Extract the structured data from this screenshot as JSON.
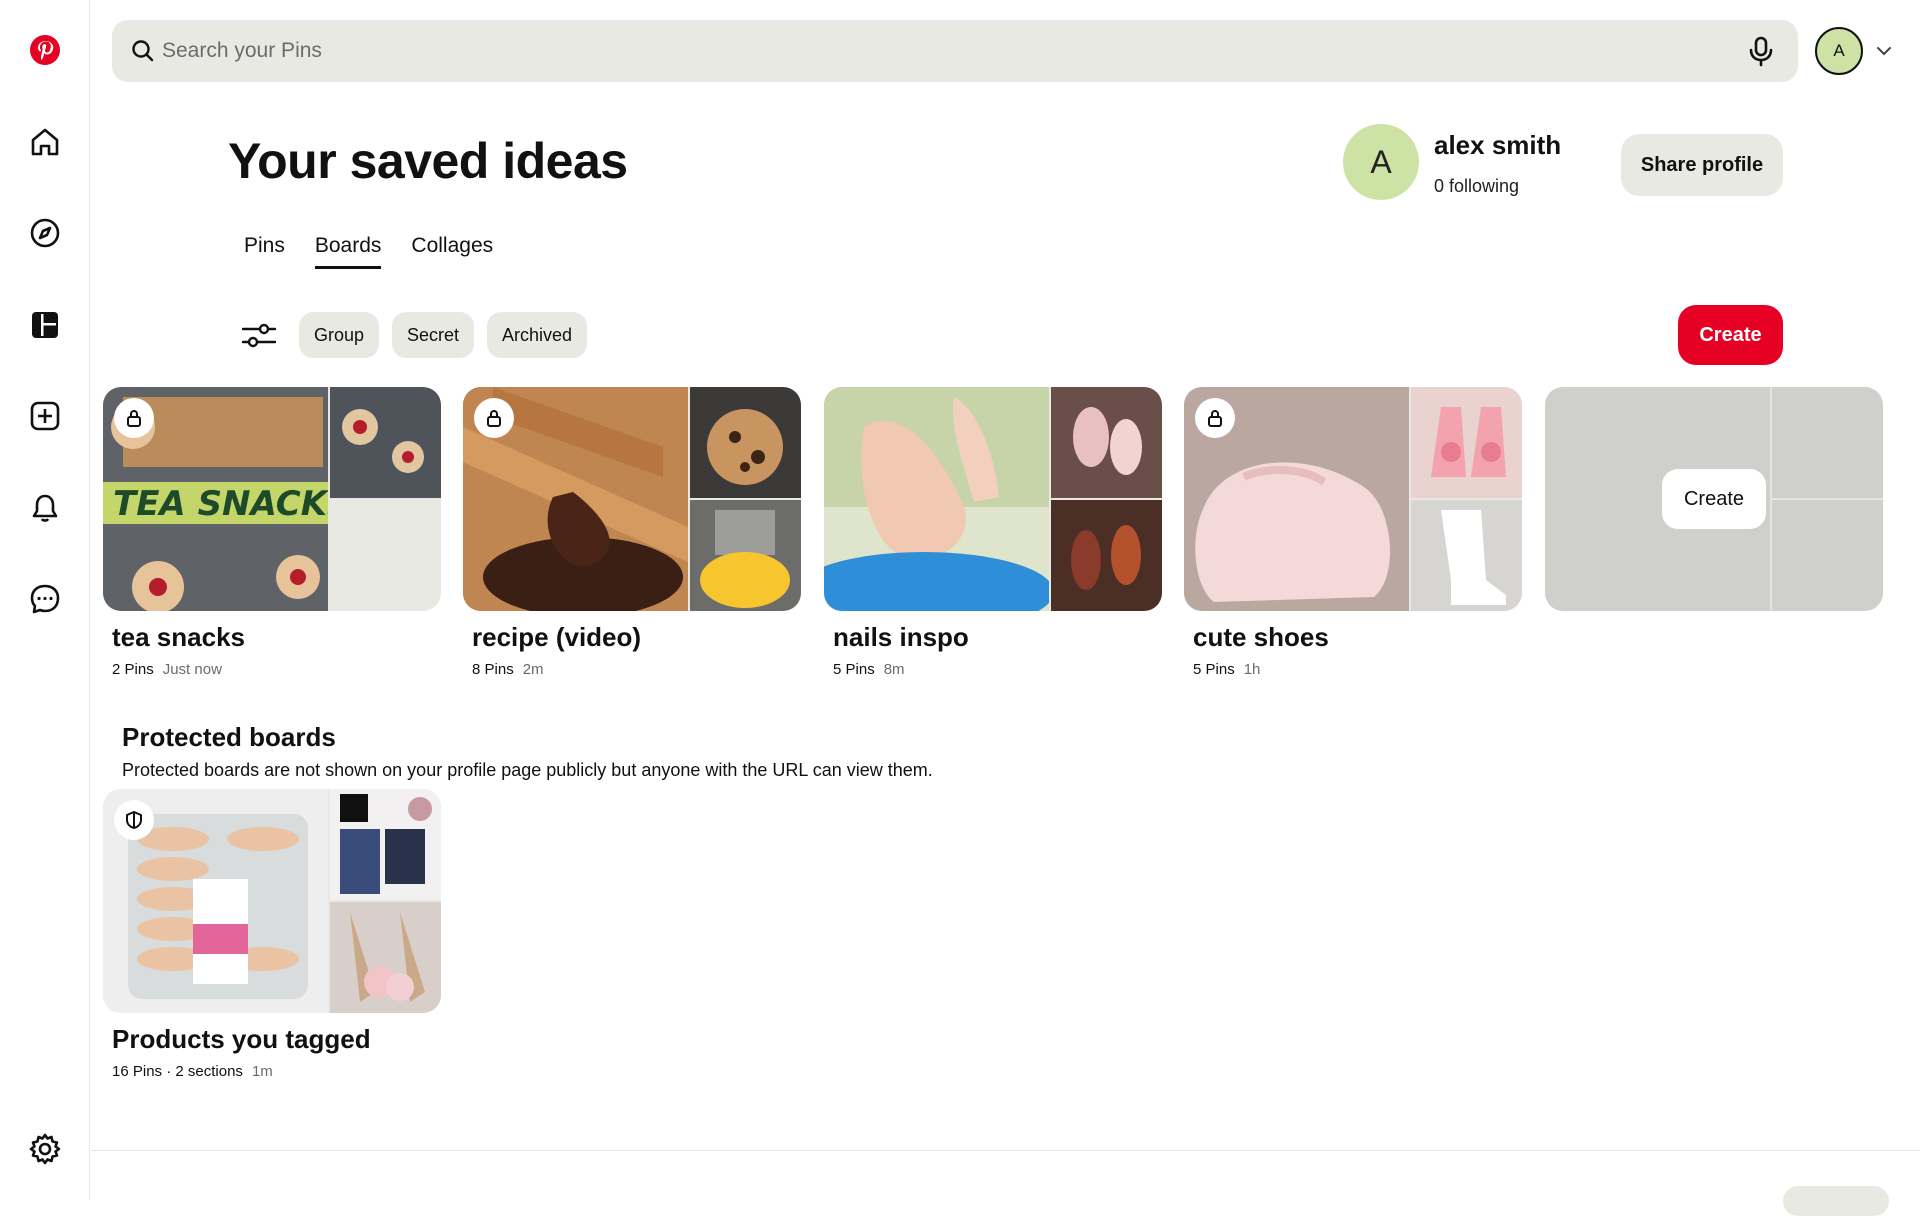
{
  "app": {
    "brand": "pinterest-logo",
    "brand_color": "#e60023"
  },
  "sidebar": {
    "items": [
      {
        "name": "home-icon"
      },
      {
        "name": "explore-icon"
      },
      {
        "name": "boards-icon"
      },
      {
        "name": "create-icon"
      },
      {
        "name": "notifications-icon"
      },
      {
        "name": "messages-icon"
      },
      {
        "name": "settings-icon"
      }
    ]
  },
  "search": {
    "placeholder": "Search your Pins",
    "value": ""
  },
  "account": {
    "avatar_letter": "A"
  },
  "header": {
    "title": "Your saved ideas"
  },
  "profile": {
    "avatar_letter": "A",
    "name": "alex smith",
    "following": "0 following",
    "share_label": "Share profile"
  },
  "tabs": [
    {
      "label": "Pins",
      "active": false
    },
    {
      "label": "Boards",
      "active": true
    },
    {
      "label": "Collages",
      "active": false
    }
  ],
  "filters": [
    "Group",
    "Secret",
    "Archived"
  ],
  "create_label": "Create",
  "boards": [
    {
      "name": "tea snacks",
      "pins": "2 Pins",
      "time": "Just now",
      "secret": true
    },
    {
      "name": "recipe (video)",
      "pins": "8 Pins",
      "time": "2m",
      "secret": true
    },
    {
      "name": "nails inspo",
      "pins": "5 Pins",
      "time": "8m",
      "secret": false
    },
    {
      "name": "cute shoes",
      "pins": "5 Pins",
      "time": "1h",
      "secret": true
    }
  ],
  "empty_board": {
    "create_label": "Create"
  },
  "protected": {
    "title": "Protected boards",
    "description": "Protected boards are not shown on your profile page publicly but anyone with the URL can view them.",
    "board": {
      "name": "Products you tagged",
      "pins": "16 Pins",
      "sections": "2 sections",
      "time": "1m",
      "cover_text": "TEA SNACKS"
    }
  },
  "cover_labels": {
    "tea": "TEA SNACKS"
  }
}
